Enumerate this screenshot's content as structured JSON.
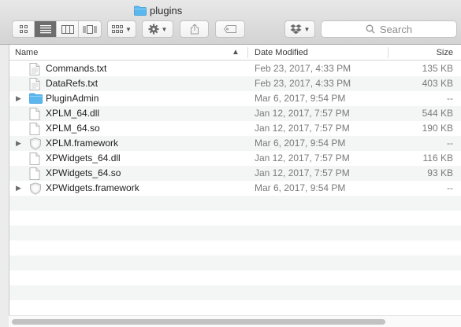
{
  "window": {
    "title": "plugins",
    "title_icon": "folder-icon"
  },
  "toolbar": {
    "view_buttons": [
      {
        "name": "icon-view",
        "icon": "grid-icon",
        "active": false
      },
      {
        "name": "list-view",
        "icon": "list-icon",
        "active": true
      },
      {
        "name": "column-view",
        "icon": "columns-icon",
        "active": false
      },
      {
        "name": "cover-flow-view",
        "icon": "coverflow-icon",
        "active": false
      }
    ],
    "arrange_icon": "arrange-icon",
    "action_icon": "gear-icon",
    "share_icon": "share-icon",
    "tag_icon": "tag-icon",
    "dropbox_icon": "dropbox-icon",
    "search": {
      "placeholder": "Search",
      "icon": "search-icon"
    }
  },
  "columns": {
    "name": "Name",
    "date": "Date Modified",
    "size": "Size"
  },
  "files": [
    {
      "name": "Commands.txt",
      "date": "Feb 23, 2017, 4:33 PM",
      "size": "135 KB",
      "kind": "text",
      "expandable": false
    },
    {
      "name": "DataRefs.txt",
      "date": "Feb 23, 2017, 4:33 PM",
      "size": "403 KB",
      "kind": "text",
      "expandable": false
    },
    {
      "name": "PluginAdmin",
      "date": "Mar 6, 2017, 9:54 PM",
      "size": "--",
      "kind": "folder",
      "expandable": true
    },
    {
      "name": "XPLM_64.dll",
      "date": "Jan 12, 2017, 7:57 PM",
      "size": "544 KB",
      "kind": "doc",
      "expandable": false
    },
    {
      "name": "XPLM_64.so",
      "date": "Jan 12, 2017, 7:57 PM",
      "size": "190 KB",
      "kind": "doc",
      "expandable": false
    },
    {
      "name": "XPLM.framework",
      "date": "Mar 6, 2017, 9:54 PM",
      "size": "--",
      "kind": "framework",
      "expandable": true
    },
    {
      "name": "XPWidgets_64.dll",
      "date": "Jan 12, 2017, 7:57 PM",
      "size": "116 KB",
      "kind": "doc",
      "expandable": false
    },
    {
      "name": "XPWidgets_64.so",
      "date": "Jan 12, 2017, 7:57 PM",
      "size": "93 KB",
      "kind": "doc",
      "expandable": false
    },
    {
      "name": "XPWidgets.framework",
      "date": "Mar 6, 2017, 9:54 PM",
      "size": "--",
      "kind": "framework",
      "expandable": true
    }
  ],
  "colors": {
    "folder": "#5ab8ef",
    "selected_view": "#6d6d6d",
    "row_alt": "#f4f5f5"
  }
}
